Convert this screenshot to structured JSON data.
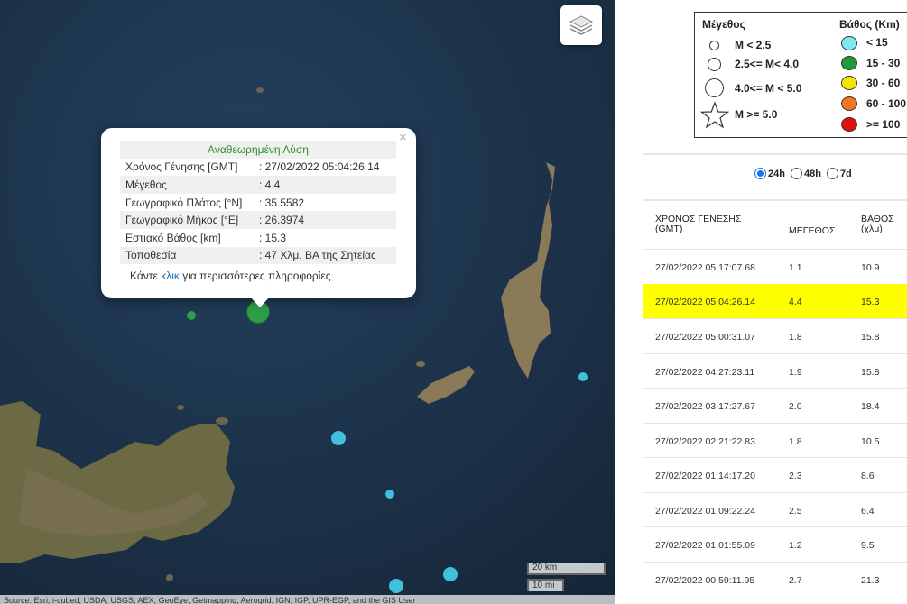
{
  "map": {
    "popup": {
      "title": "Αναθεωρημένη Λύση",
      "rows": [
        {
          "label": "Χρόνος Γένησης [GMT]",
          "value": "27/02/2022 05:04:26.14"
        },
        {
          "label": "Μέγεθος",
          "value": "4.4"
        },
        {
          "label": "Γεωγραφικό Πλάτος [°N]",
          "value": "35.5582"
        },
        {
          "label": "Γεωγραφικό Μήκος [°E]",
          "value": "26.3974"
        },
        {
          "label": "Εστιακό Βάθος [km]",
          "value": "15.3"
        },
        {
          "label": "Τοποθεσία",
          "value": "47 Χλμ. ΒΑ της Σητείας"
        }
      ],
      "more_prefix": "Κάντε ",
      "more_link": "κλικ",
      "more_suffix": " για περισσότερες πληροφορίες",
      "close": "×"
    },
    "scale": {
      "km": "20 km",
      "mi": "10 mi"
    },
    "attribution": "Source: Esri, i-cubed, USDA, USGS, AEX, GeoEye, Getmapping, Aerogrid, IGN, IGP, UPR-EGP, and the GIS User",
    "layers_icon": "layers-icon",
    "colors": {
      "sea": "#1b2f45",
      "green": "#2e9e48",
      "cyan": "#3fc0db"
    }
  },
  "legend": {
    "magnitude_title": "Μέγεθος",
    "depth_title": "Βάθος (Km)",
    "magnitudes": [
      "M < 2.5",
      "2.5<= M< 4.0",
      "4.0<= M < 5.0",
      "M >= 5.0"
    ],
    "depths": [
      {
        "label": "< 15",
        "color": "#7ee8f0"
      },
      {
        "label": "15 - 30",
        "color": "#1f9a3a"
      },
      {
        "label": "30 - 60",
        "color": "#f2e600"
      },
      {
        "label": "60 - 100",
        "color": "#f2761e"
      },
      {
        "label": ">= 100",
        "color": "#e01010"
      }
    ]
  },
  "filter": {
    "options": [
      "24h",
      "48h",
      "7d"
    ],
    "selected": "24h"
  },
  "table": {
    "headers": {
      "time": "ΧΡΟΝΟΣ ΓΕΝΕΣΗΣ\n(GMT)",
      "magnitude": "ΜΕΓΕΘΟΣ",
      "depth": "ΒΑΘΟΣ\n(χλμ)"
    },
    "highlight_color": "#ffff00",
    "rows": [
      {
        "time": "27/02/2022 05:17:07.68",
        "magnitude": "1.1",
        "depth": "10.9"
      },
      {
        "time": "27/02/2022 05:04:26.14",
        "magnitude": "4.4",
        "depth": "15.3",
        "highlighted": true
      },
      {
        "time": "27/02/2022 05:00:31.07",
        "magnitude": "1.8",
        "depth": "15.8"
      },
      {
        "time": "27/02/2022 04:27:23.11",
        "magnitude": "1.9",
        "depth": "15.8"
      },
      {
        "time": "27/02/2022 03:17:27.67",
        "magnitude": "2.0",
        "depth": "18.4"
      },
      {
        "time": "27/02/2022 02:21:22.83",
        "magnitude": "1.8",
        "depth": "10.5"
      },
      {
        "time": "27/02/2022 01:14:17.20",
        "magnitude": "2.3",
        "depth": "8.6"
      },
      {
        "time": "27/02/2022 01:09:22.24",
        "magnitude": "2.5",
        "depth": "6.4"
      },
      {
        "time": "27/02/2022 01:01:55.09",
        "magnitude": "1.2",
        "depth": "9.5"
      },
      {
        "time": "27/02/2022 00:59:11.95",
        "magnitude": "2.7",
        "depth": "21.3"
      }
    ]
  }
}
